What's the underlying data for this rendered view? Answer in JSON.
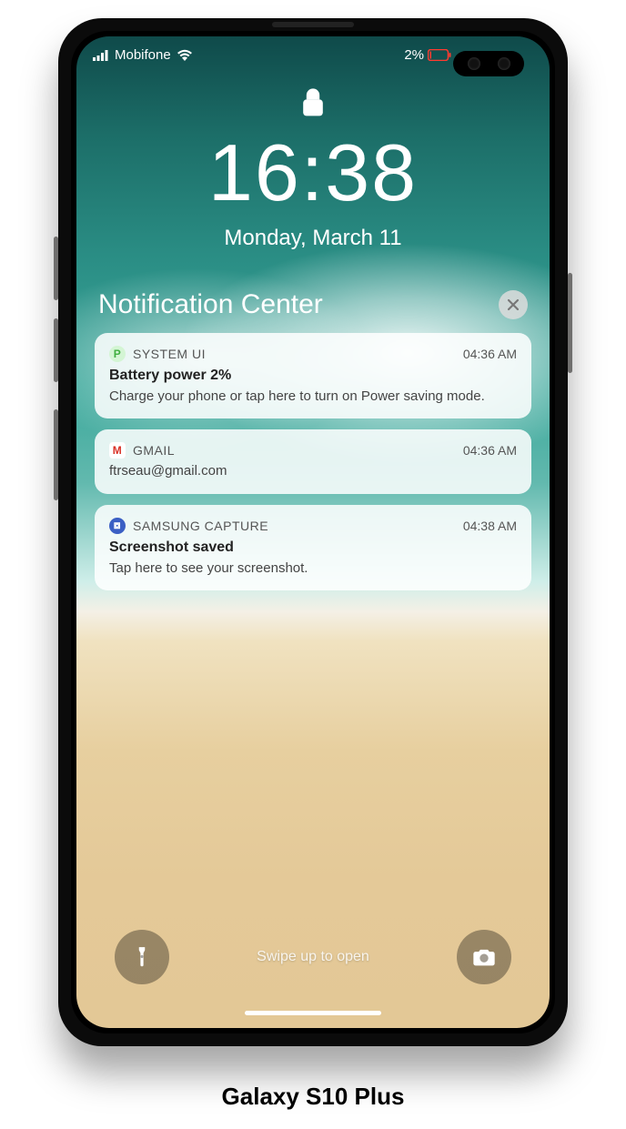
{
  "status": {
    "carrier": "Mobifone",
    "battery_text": "2%"
  },
  "lock": {
    "time": "16:38",
    "date": "Monday, March 11"
  },
  "nc": {
    "title": "Notification Center"
  },
  "notifications": [
    {
      "app": "SYSTEM UI",
      "time": "04:36 AM",
      "title": "Battery power 2%",
      "body": "Charge your phone or tap here to turn on Power saving mode.",
      "icon": "sys",
      "icon_glyph": "P"
    },
    {
      "app": "GMAIL",
      "time": "04:36 AM",
      "title": "",
      "body": "ftrseau@gmail.com",
      "icon": "gmail",
      "icon_glyph": "M"
    },
    {
      "app": "SAMSUNG CAPTURE",
      "time": "04:38 AM",
      "title": "Screenshot saved",
      "body": "Tap here to see your screenshot.",
      "icon": "samsung",
      "icon_glyph": "⧇"
    }
  ],
  "swipe_hint": "Swipe up to open",
  "device_caption": "Galaxy S10 Plus"
}
